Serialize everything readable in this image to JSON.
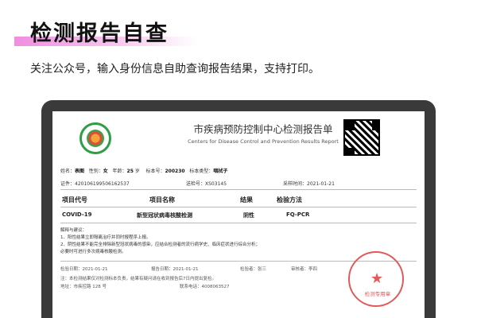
{
  "header": {
    "title": "检测报告自查",
    "subtitle": "关注公众号，输入身份信息自助查询报告结果，支持打印。"
  },
  "report": {
    "org_cn": "市疾病预防控制中心检测报告单",
    "org_en": "Centers for Disease Control and Prevention Results Report",
    "info": {
      "name_label": "姓名：",
      "name_value": "表图",
      "sex_label": "性别：",
      "sex_value": "女",
      "age_label": "年龄：",
      "age_value": "25",
      "age_unit": "岁",
      "sample_no_label": "标本号：",
      "sample_no_value": "200230",
      "sample_type_label": "标本类型：",
      "sample_type_value": "咽拭子",
      "id_label": "证件：",
      "id_value": "420106199506162537",
      "barcode_label": "送检号：",
      "barcode_value": "XS03145",
      "collect_label": "采样时间：",
      "collect_value": "2021-01-21"
    },
    "table": {
      "headers": [
        "项目代号",
        "项目名称",
        "结果",
        "检验方法"
      ],
      "row": [
        "COVID-19",
        "新型冠状病毒核酸检测",
        "阴性",
        "FQ-PCR"
      ]
    },
    "notes": [
      "解释与建议：",
      "1、阳性结果立即隔离治疗并同时报程序上报。",
      "2、阴性结果不能完全排除新型冠状病毒的感染，应结合检测者的流行病学史、临床症状进行综合分析；",
      "必要时可进行多次病毒核酸检测。"
    ],
    "footer": {
      "inspect_label": "检验日期：",
      "inspect_value": "2021-01-21",
      "report_label": "报告日期：",
      "report_value": "2021-01-21",
      "tester_label": "检验者：",
      "tester_value": "张三",
      "reviewer_label": "审核者：",
      "reviewer_value": "李四",
      "disclaimer": "注：本检测结果仅对检测标本负责，结果有疑问请在收到报告后7日内提出复检。",
      "address": "地址：市疾控路 128 号",
      "phone_label": "联系电话：",
      "phone_value": "4008063527"
    },
    "stamp_text": "检测专用章"
  }
}
